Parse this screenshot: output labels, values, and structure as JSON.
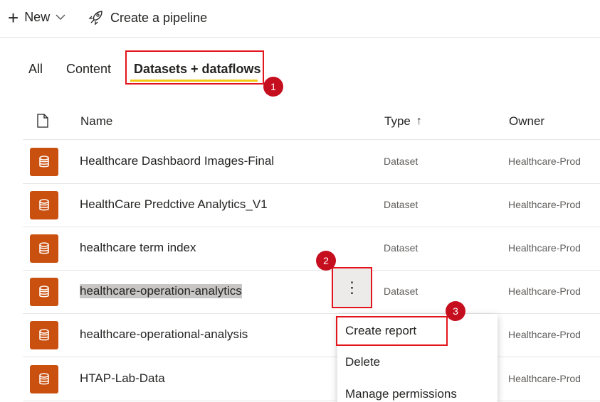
{
  "toolbar": {
    "new_label": "New",
    "pipeline_label": "Create a pipeline"
  },
  "tabs": [
    {
      "label": "All"
    },
    {
      "label": "Content"
    },
    {
      "label": "Datasets + dataflows"
    }
  ],
  "table": {
    "headers": {
      "name": "Name",
      "type": "Type",
      "owner": "Owner"
    },
    "sort_indicator": "↑",
    "rows": [
      {
        "name": "Healthcare Dashbaord Images-Final",
        "type": "Dataset",
        "owner": "Healthcare-Prod"
      },
      {
        "name": "HealthCare Predctive Analytics_V1",
        "type": "Dataset",
        "owner": "Healthcare-Prod"
      },
      {
        "name": "healthcare term index",
        "type": "Dataset",
        "owner": "Healthcare-Prod"
      },
      {
        "name": "healthcare-operation-analytics",
        "type": "Dataset",
        "owner": "Healthcare-Prod"
      },
      {
        "name": "healthcare-operational-analysis",
        "type": "",
        "owner": "Healthcare-Prod"
      },
      {
        "name": "HTAP-Lab-Data",
        "type": "",
        "owner": "Healthcare-Prod"
      }
    ]
  },
  "more_button": {
    "glyph": "⋮"
  },
  "context_menu": {
    "items": [
      {
        "label": "Create report"
      },
      {
        "label": "Delete"
      },
      {
        "label": "Manage permissions"
      }
    ]
  },
  "callouts": {
    "one": "1",
    "two": "2",
    "three": "3"
  },
  "colors": {
    "dataset_icon": "#ca5010",
    "callout": "#e3141c",
    "tab_underline": "#f2c811"
  }
}
